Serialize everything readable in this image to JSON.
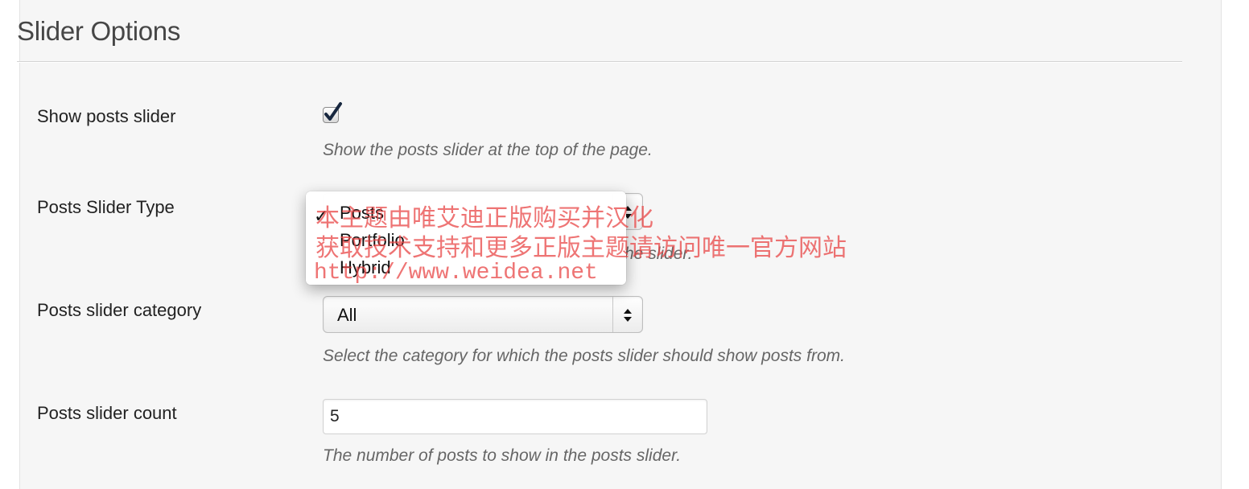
{
  "section": {
    "title": "Slider Options"
  },
  "fields": {
    "show_slider": {
      "label": "Show posts slider",
      "checked": true,
      "description": "Show the posts slider at the top of the page."
    },
    "slider_type": {
      "label": "Posts Slider Type",
      "description_visible": "he slider.",
      "selected": "Posts",
      "options": [
        "Posts",
        "Portfolio",
        "Hybrid"
      ]
    },
    "slider_category": {
      "label": "Posts slider category",
      "selected": "All",
      "description": "Select the category for which the posts slider should show posts from."
    },
    "slider_count": {
      "label": "Posts slider count",
      "value": "5",
      "description": "The number of posts to show in the posts slider."
    }
  },
  "watermark": {
    "line1": "本主题由唯艾迪正版购买并汉化",
    "line2": "获取技术支持和更多正版主题请访问唯一官方网站",
    "line3": "http://www.weidea.net"
  },
  "colors": {
    "panel_bg": "#f6f6f6",
    "checkbox_check": "#17273f",
    "watermark": "#e84646"
  }
}
